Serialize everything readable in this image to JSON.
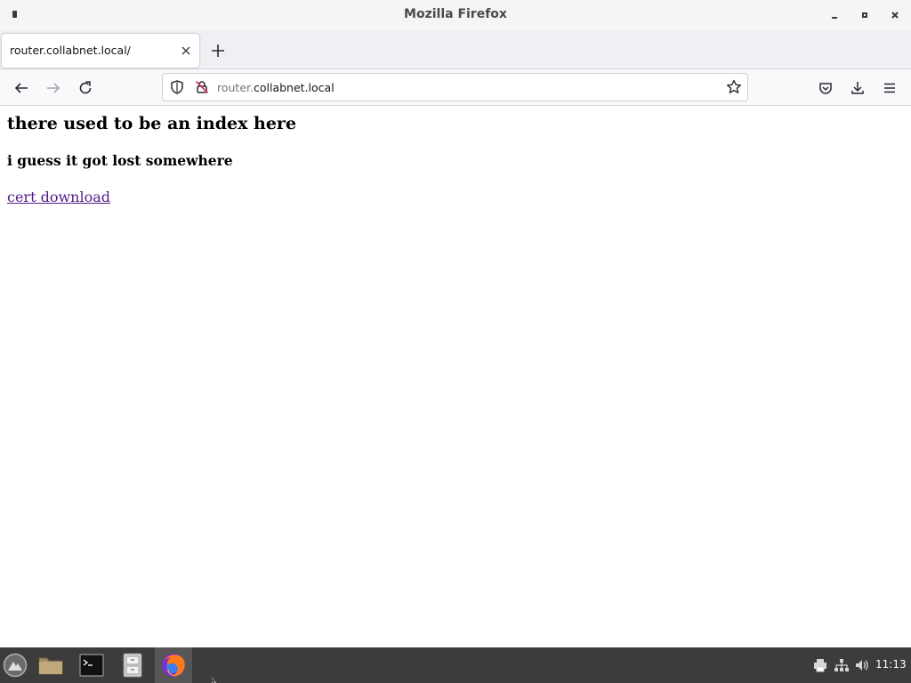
{
  "window": {
    "title": "Mozilla Firefox"
  },
  "tabs": [
    {
      "label": "router.collabnet.local/",
      "active": true
    }
  ],
  "urlbar": {
    "host_prefix": "router.",
    "host_main": "collabnet.local"
  },
  "page": {
    "heading": "there used to be an index here",
    "subheading": "i guess it got lost somewhere",
    "link_text": "cert download"
  },
  "taskbar": {
    "clock": "11:13",
    "apps": [
      {
        "name": "menu-launcher-icon"
      },
      {
        "name": "file-manager-icon"
      },
      {
        "name": "terminal-icon"
      },
      {
        "name": "file-cabinet-icon"
      },
      {
        "name": "firefox-icon",
        "active": true
      }
    ],
    "tray": [
      "printer-icon",
      "network-icon",
      "volume-icon"
    ]
  },
  "colors": {
    "link_visited": "#551a8b",
    "taskbar_bg": "#3c3c3c",
    "toolbar_bg": "#f9f9fb"
  }
}
